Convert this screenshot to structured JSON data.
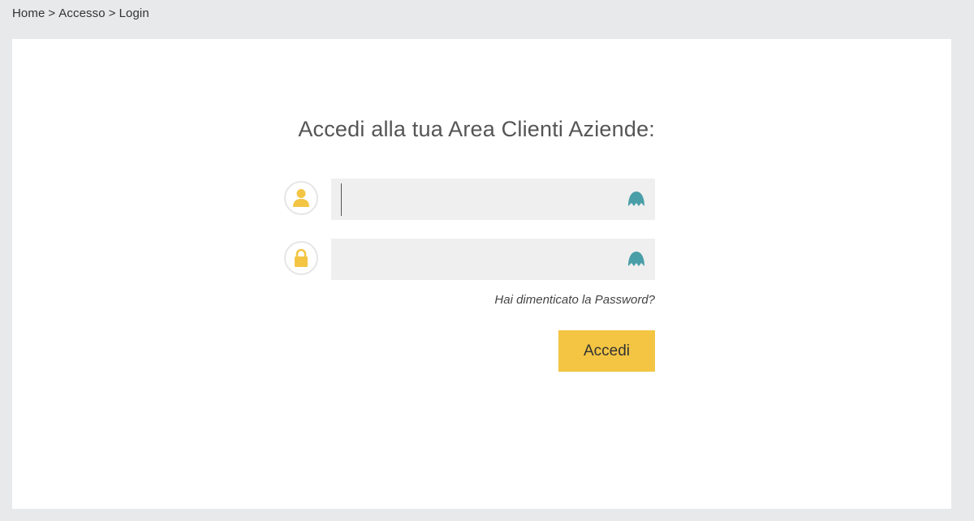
{
  "breadcrumb": {
    "items": [
      "Home",
      "Accesso",
      "Login"
    ],
    "separator": ">"
  },
  "login": {
    "title": "Accedi alla tua Area Clienti Aziende:",
    "username": {
      "value": "",
      "icon": "user-icon"
    },
    "password": {
      "value": "",
      "icon": "lock-icon"
    },
    "autofill_icon": "password-manager-icon",
    "forgot_password_label": "Hai dimenticato la Password?",
    "submit_label": "Accedi"
  },
  "colors": {
    "page_background": "#e8e9eb",
    "panel_background": "#ffffff",
    "input_background": "#efefef",
    "accent_yellow": "#f3c543",
    "icon_yellow": "#f3c543",
    "autofill_teal": "#4a9ea8"
  }
}
